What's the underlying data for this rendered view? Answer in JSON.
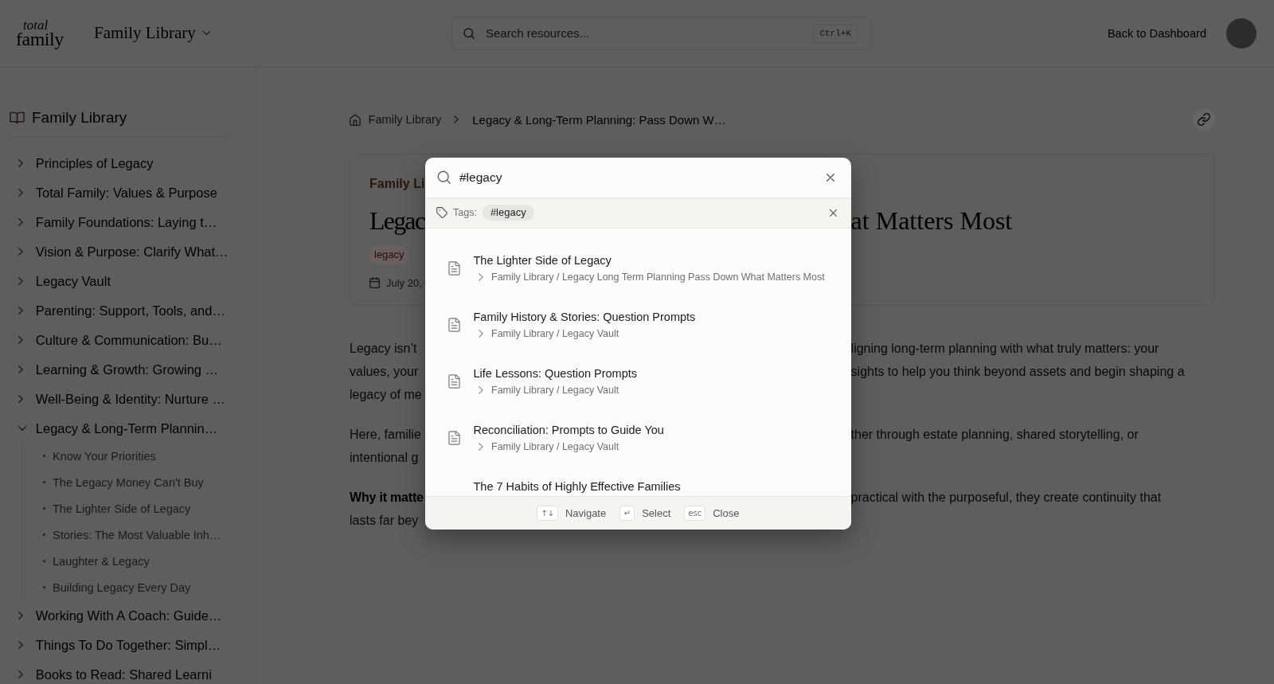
{
  "header": {
    "logo": {
      "line_1": "total",
      "line_2": "family"
    },
    "library_menu": {
      "label": "Family Library"
    },
    "search": {
      "placeholder": "Search resources...",
      "shortcut": "Ctrl+K"
    },
    "back_link": "Back to Dashboard"
  },
  "sidebar": {
    "title": "Family Library",
    "items": [
      {
        "label": "Principles of Legacy",
        "expanded": false
      },
      {
        "label": "Total Family: Values & Purpose",
        "expanded": false
      },
      {
        "label": "Family Foundations: Laying t…",
        "expanded": false
      },
      {
        "label": "Vision & Purpose: Clarify What…",
        "expanded": false
      },
      {
        "label": "Legacy Vault",
        "expanded": false
      },
      {
        "label": "Parenting: Support, Tools, and…",
        "expanded": false
      },
      {
        "label": "Culture & Communication: Bu…",
        "expanded": false
      },
      {
        "label": "Learning & Growth: Growing …",
        "expanded": false
      },
      {
        "label": "Well-Being & Identity: Nurture …",
        "expanded": false
      },
      {
        "label": "Legacy & Long-Term Plannin…",
        "expanded": true,
        "children": [
          {
            "label": "Know Your Priorities"
          },
          {
            "label": "The Legacy Money Can't Buy"
          },
          {
            "label": "The Lighter Side of Legacy"
          },
          {
            "label": "Stories: The Most Valuable Inh…"
          },
          {
            "label": "Laughter & Legacy"
          },
          {
            "label": "Building Legacy Every Day"
          }
        ]
      },
      {
        "label": "Working With A Coach: Guide…",
        "expanded": false
      },
      {
        "label": "Things To Do Together: Simpl…",
        "expanded": false
      },
      {
        "label": "Books to Read: Shared Learni",
        "expanded": false
      }
    ]
  },
  "breadcrumb": [
    {
      "label": "Family Library",
      "kind": "home"
    },
    {
      "label": "Legacy & Long-Term Planning: Pass Down W…",
      "kind": "current"
    }
  ],
  "article": {
    "category": "Family Li",
    "title": {
      "left": "Legac",
      "right": "at Matters Most"
    },
    "tag": "legacy",
    "date": "July 20,",
    "paragraphs": [
      {
        "kind": "body",
        "lines": [
          {
            "left": "Legacy isn’t",
            "right": "ligning long-term planning with what truly matters: your"
          },
          {
            "left": "values, your",
            "right": "sights to help you think beyond assets and begin shaping a"
          },
          {
            "left": "legacy of me"
          }
        ]
      },
      {
        "kind": "body",
        "lines": [
          {
            "left": "Here, familie",
            "right": "ther through estate planning, shared storytelling, or"
          },
          {
            "left": "intentional g"
          }
        ]
      },
      {
        "kind": "key-point",
        "lines": [
          {
            "left": "Why it matte",
            "right": "practical with the purposeful, they create continuity that"
          },
          {
            "left": "lasts far bey"
          }
        ]
      }
    ]
  },
  "search_dialog": {
    "query": "#legacy",
    "tags_label": "Tags:",
    "tags": [
      "#legacy"
    ],
    "results": [
      {
        "title": "The Lighter Side of Legacy",
        "path": "Family Library / Legacy Long Term Planning Pass Down What Matters Most"
      },
      {
        "title": "Family History & Stories: Question Prompts",
        "path": "Family Library / Legacy Vault"
      },
      {
        "title": "Life Lessons: Question Prompts",
        "path": "Family Library / Legacy Vault"
      },
      {
        "title": "Reconciliation: Prompts to Guide You",
        "path": "Family Library / Legacy Vault"
      }
    ],
    "partially_hidden_result": {
      "title": "The 7 Habits of Highly Effective Families"
    },
    "hints": [
      {
        "key": "↑↓",
        "label": "Navigate"
      },
      {
        "key": "↵",
        "label": "Select"
      },
      {
        "key": "esc",
        "label": "Close"
      }
    ]
  }
}
